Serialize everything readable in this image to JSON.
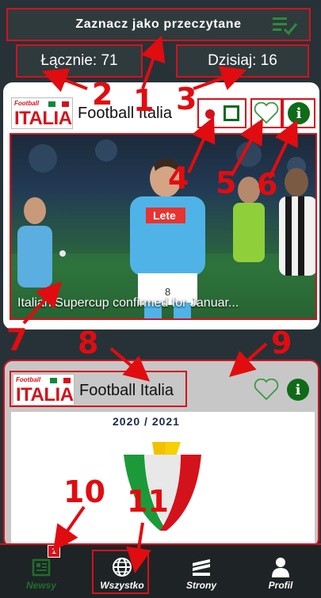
{
  "header": {
    "mark_read_label": "Zaznacz jako przeczytane",
    "total_label": "Łącznie: 71",
    "today_label": "Dzisiaj: 16"
  },
  "feed": [
    {
      "source": "Football Italia",
      "logo_small": "Football",
      "logo_big": "ITALIA",
      "title": "Italian Supercup confirmed for Januar..."
    },
    {
      "source": "Football Italia",
      "logo_small": "Football",
      "logo_big": "ITALIA",
      "season": "2020 / 2021"
    }
  ],
  "bottom_nav": {
    "items": [
      {
        "label": "Newsy",
        "badge": "1"
      },
      {
        "label": "Wszystko"
      },
      {
        "label": "Strony"
      },
      {
        "label": "Profil"
      }
    ]
  },
  "annotations": [
    "1",
    "2",
    "3",
    "4",
    "5",
    "6",
    "7",
    "8",
    "9",
    "10",
    "11"
  ],
  "colors": {
    "background": "#263238",
    "highlight_red": "#d4121b",
    "green": "#106b18",
    "nav_bg": "#1e2426"
  }
}
